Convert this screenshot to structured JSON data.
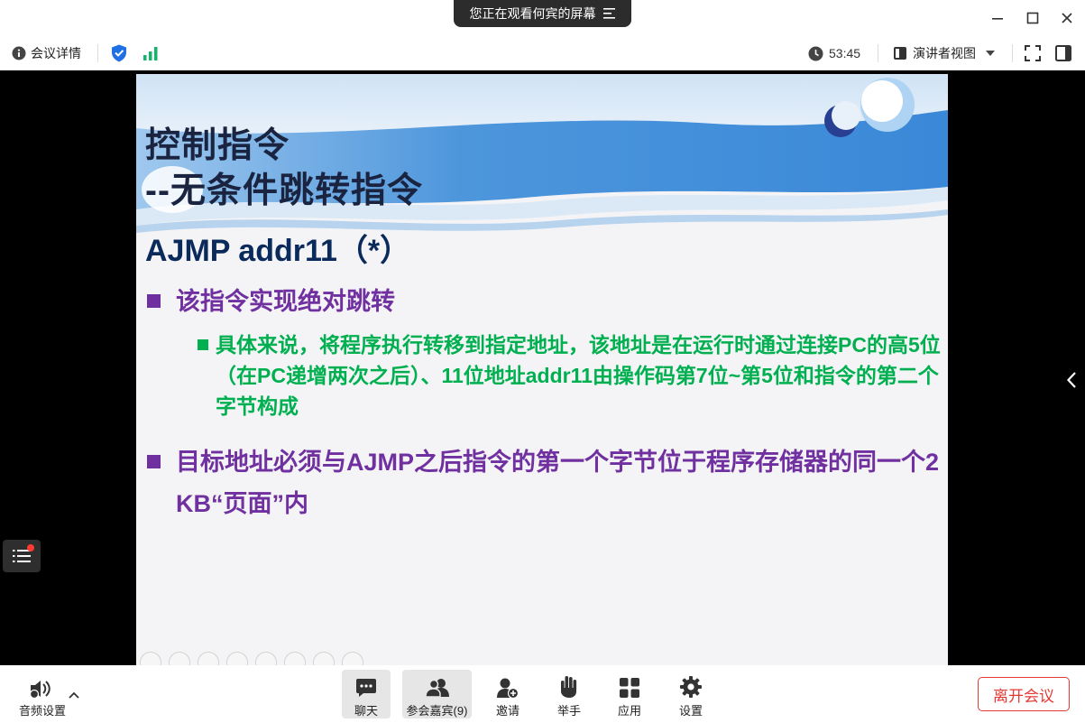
{
  "window": {
    "share_banner": "您正在观看何宾的屏幕",
    "controls": [
      {
        "name": "minimize-icon"
      },
      {
        "name": "maximize-icon"
      },
      {
        "name": "close-icon"
      }
    ]
  },
  "infobar": {
    "meeting_info_label": "会议详情",
    "timer": "53:45",
    "view_mode_label": "演讲者视图",
    "icons": [
      "info-icon",
      "shield-check-icon",
      "signal-icon",
      "clock-icon",
      "presenter-view-icon",
      "chevron-down-icon",
      "fullscreen-icon",
      "sidebar-toggle-icon"
    ]
  },
  "slide": {
    "title_line1": "控制指令",
    "title_line2": "--无条件跳转指令",
    "heading": "AJMP addr11（*）",
    "bullet1": "该指令实现绝对跳转",
    "sub_bullet1": "具体来说，将程序执行转移到指定地址，该地址是在运行时通过连接PC的高5位（在PC递增两次之后）、11位地址addr11由操作码第7位~第5位和指令的第二个字节构成",
    "bullet2": "目标地址必须与AJMP之后指令的第一个字节位于程序存储器的同一个2 KB“页面”内",
    "colors": {
      "title": "#1a2440",
      "heading": "#0b2a5c",
      "bullet": "#7030a0",
      "sub_bullet": "#00b050"
    }
  },
  "side": {
    "left_button_icon": "list-icon",
    "right_button_icon": "chevron-left-icon"
  },
  "toolbar": {
    "audio_label": "音频设置",
    "buttons": [
      {
        "label": "聊天",
        "icon": "chat-icon",
        "active": true
      },
      {
        "label": "参会嘉宾(9)",
        "icon": "participants-icon",
        "active": true
      },
      {
        "label": "邀请",
        "icon": "invite-icon",
        "active": false
      },
      {
        "label": "举手",
        "icon": "raise-hand-icon",
        "active": false
      },
      {
        "label": "应用",
        "icon": "apps-icon",
        "active": false
      },
      {
        "label": "设置",
        "icon": "gear-icon",
        "active": false
      }
    ],
    "leave_label": "离开会议",
    "leave_color": "#e53935"
  }
}
